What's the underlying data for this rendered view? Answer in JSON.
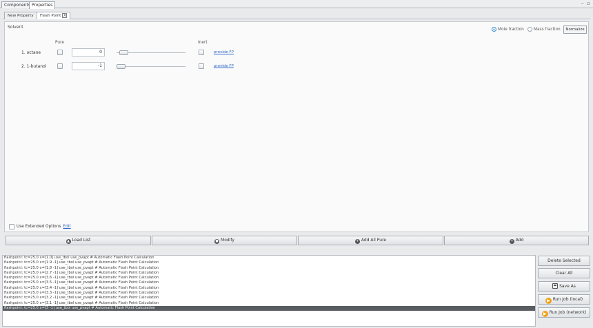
{
  "top_tabs": [
    {
      "label": "Components"
    },
    {
      "label": "Properties"
    }
  ],
  "window_controls": {
    "minimize": "–",
    "restore": "▫"
  },
  "sub_tabs": [
    {
      "label": "New Property"
    },
    {
      "label": "Flash Point"
    }
  ],
  "close_glyph": "X",
  "solvent": {
    "title": "Solvent",
    "mole_fraction": "Mole fraction",
    "mass_fraction": "Mass fraction",
    "normalize": "Normalize",
    "selected_basis": "mole",
    "col_pure": "Pure",
    "col_inert": "Inert",
    "rows": [
      {
        "label": "1. octane",
        "value": "0",
        "slider": 0.05,
        "provide": "provide FP"
      },
      {
        "label": "2. 1-butanol",
        "value": "-1",
        "slider": 0.0,
        "provide": "provide FP"
      }
    ],
    "extended_label": "Use Extended Options",
    "edit_label": "Edit"
  },
  "actions": {
    "load": "Load List",
    "modify": "Modify",
    "add_all_pure": "Add All Pure",
    "add": "Add"
  },
  "log": [
    "flashpoint: tc=25.0  x=[1.0]  use_tbol use_pvapt # Automatic Flash Point Calculation",
    "flashpoint: tc=25.0  x=[1.9 -1]  use_tbol use_pvapt # Automatic Flash Point Calculation",
    "flashpoint: tc=25.0  x=[1.8 -1]  use_tbol use_pvapt # Automatic Flash Point Calculation",
    "flashpoint: tc=25.0  x=[2.7 -1]  use_tbol use_pvapt # Automatic Flash Point Calculation",
    "flashpoint: tc=25.0  x=[3.6 -1]  use_tbol use_pvapt # Automatic Flash Point Calculation",
    "flashpoint: tc=25.0  x=[3.5 -1]  use_tbol use_pvapt # Automatic Flash Point Calculation",
    "flashpoint: tc=25.0  x=[3.4 -1]  use_tbol use_pvapt # Automatic Flash Point Calculation",
    "flashpoint: tc=25.0  x=[3.3 -1]  use_tbol use_pvapt # Automatic Flash Point Calculation",
    "flashpoint: tc=25.0  x=[3.2 -1]  use_tbol use_pvapt # Automatic Flash Point Calculation",
    "flashpoint: tc=25.0  x=[3.1 -1]  use_tbol use_pvapt # Automatic Flash Point Calculation",
    "flashpoint: tc=25.0  x=[3 -1]  use_tbol use_pvapt # Automatic Flash Point Calculation"
  ],
  "side_buttons": {
    "delete": "Delete Selected",
    "clear": "Clear All",
    "save": "Save As",
    "run_local": "Run Job (local)",
    "run_network": "Run Job (network)"
  },
  "colors": {
    "link": "#2d66c6",
    "accent": "#f0a21a",
    "selected_row": "#595d61"
  }
}
